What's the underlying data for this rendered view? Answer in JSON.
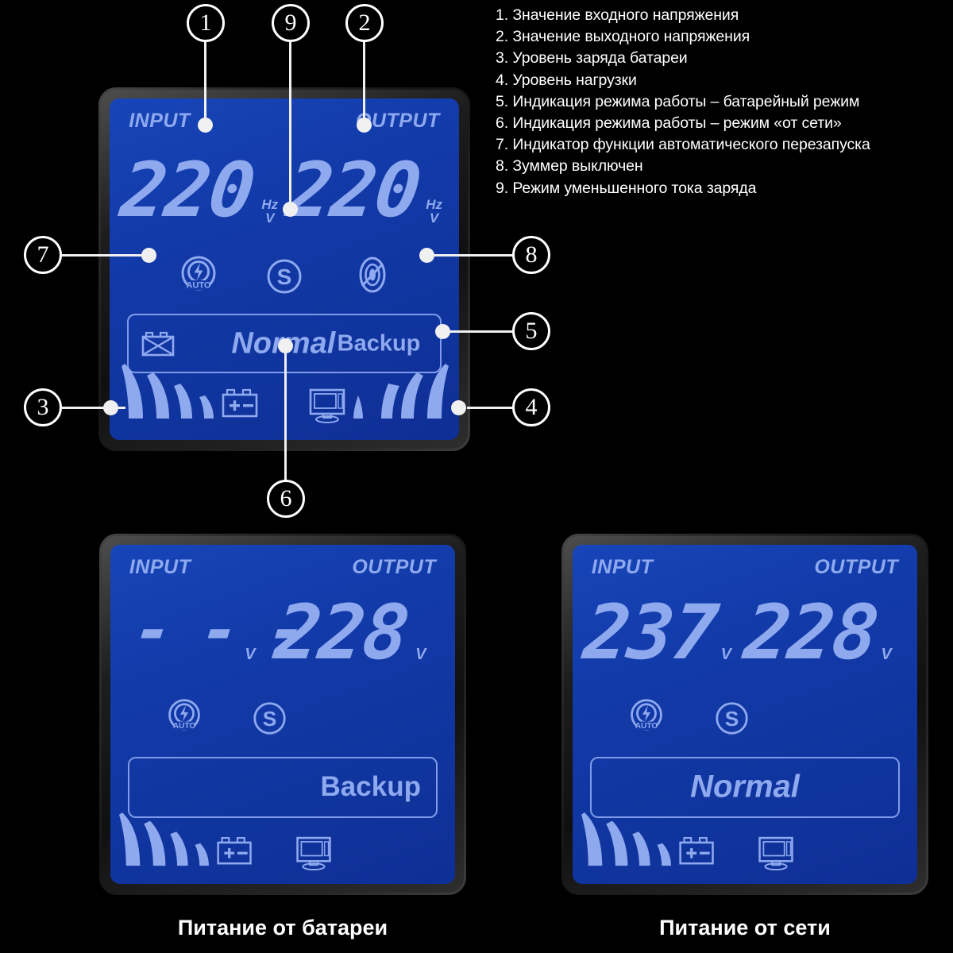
{
  "legend": {
    "items": [
      "1. Значение входного напряжения",
      "2. Значение выходного напряжения",
      "3. Уровень заряда батареи",
      "4. Уровень нагрузки",
      "5. Индикация режима работы – батарейный режим",
      "6. Индикация режима работы – режим «от сети»",
      "7. Индикатор функции автоматического перезапуска",
      "8. Зуммер выключен",
      "9. Режим уменьшенного тока заряда"
    ]
  },
  "colors": {
    "lcd_background": "#123aa8",
    "lcd_segment": "#8fa9ef",
    "bezel": "#242424",
    "page_background": "#000000",
    "callout_stroke": "#ffffff",
    "text": "#ffffff"
  },
  "main_panel": {
    "name": "main-reference-lcd",
    "input_label": "INPUT",
    "output_label": "OUTPUT",
    "input_value": "220",
    "output_value": "220",
    "input_unit_top": "Hz",
    "input_unit_bottom": "V",
    "output_unit_top": "Hz",
    "output_unit_bottom": "V",
    "auto_icon_label": "AUTO",
    "saver_icon_label": "S",
    "mute_icon_label": "mute",
    "mode_normal": "Normal",
    "mode_backup": "Backup",
    "battery_fault_icon": "battery-fault",
    "battery_icon": "battery",
    "load_icon": "monitor",
    "battery_bars": 4,
    "load_bars": 4
  },
  "callouts": [
    {
      "id": "1",
      "label": "1"
    },
    {
      "id": "2",
      "label": "2"
    },
    {
      "id": "3",
      "label": "3"
    },
    {
      "id": "4",
      "label": "4"
    },
    {
      "id": "5",
      "label": "5"
    },
    {
      "id": "6",
      "label": "6"
    },
    {
      "id": "7",
      "label": "7"
    },
    {
      "id": "8",
      "label": "8"
    },
    {
      "id": "9",
      "label": "9"
    }
  ],
  "battery_panel": {
    "name": "battery-mode-lcd",
    "input_label": "INPUT",
    "output_label": "OUTPUT",
    "input_value": "- - -",
    "output_value": "228",
    "input_unit": "V",
    "output_unit": "V",
    "auto_icon_label": "AUTO",
    "saver_icon_label": "S",
    "mode_text": "Backup",
    "battery_bars": 4,
    "load_bars": 0,
    "caption": "Питание от батареи"
  },
  "mains_panel": {
    "name": "mains-mode-lcd",
    "input_label": "INPUT",
    "output_label": "OUTPUT",
    "input_value": "237",
    "output_value": "228",
    "input_unit": "V",
    "output_unit": "V",
    "auto_icon_label": "AUTO",
    "saver_icon_label": "S",
    "mode_text": "Normal",
    "battery_bars": 4,
    "load_bars": 0,
    "caption": "Питание от сети"
  }
}
